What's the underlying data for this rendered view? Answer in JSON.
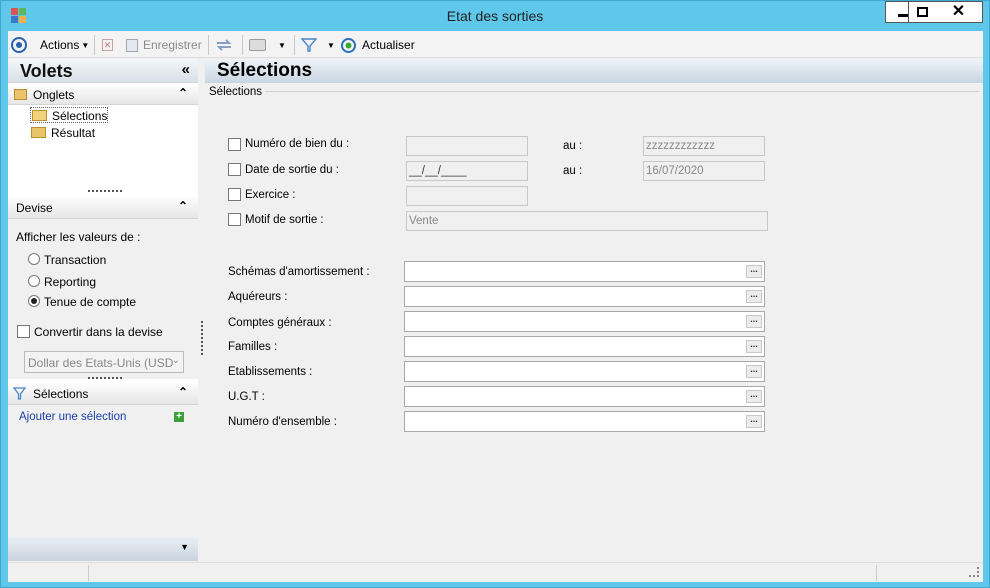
{
  "window": {
    "title": "Etat des sorties"
  },
  "toolbar": {
    "actions_label": "Actions",
    "save_label": "Enregistrer",
    "refresh_label": "Actualiser"
  },
  "sidebar": {
    "title": "Volets",
    "onglets": {
      "title": "Onglets",
      "items": [
        "Sélections",
        "Résultat"
      ]
    },
    "devise": {
      "title": "Devise",
      "prompt": "Afficher les valeurs de :",
      "options": [
        "Transaction",
        "Reporting",
        "Tenue de compte"
      ],
      "selected": "Tenue de compte",
      "convert_label": "Convertir dans la devise",
      "currency_value": "Dollar des Etats-Unis (USD"
    },
    "selections": {
      "title": "Sélections",
      "add_link": "Ajouter une sélection"
    }
  },
  "main": {
    "title": "Sélections",
    "group_label": "Sélections",
    "criteria": {
      "numero_label": "Numéro de bien du :",
      "numero_from": "",
      "numero_to_label": "au :",
      "numero_to": "zzzzzzzzzzzz",
      "date_label": "Date de sortie du :",
      "date_from": "__/__/____",
      "date_to_label": "au :",
      "date_to": "16/07/2020",
      "exercice_label": "Exercice :",
      "exercice_value": "",
      "motif_label": "Motif de sortie :",
      "motif_value": "Vente"
    },
    "lookups": [
      "Schémas d'amortissement :",
      "Aquéreurs :",
      "Comptes généraux :",
      "Familles :",
      "Etablissements :",
      "U.G.T :",
      "Numéro d'ensemble :"
    ],
    "lookup_button": "..."
  },
  "colors": {
    "window_border": "#5fc8ea",
    "link": "#1a3ea8",
    "accent_green": "#3aa03a"
  }
}
